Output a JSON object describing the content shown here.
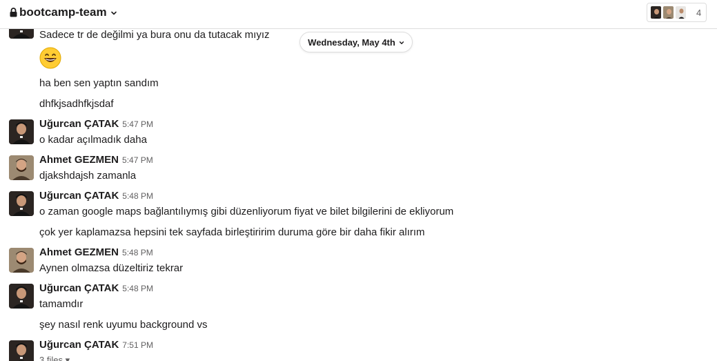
{
  "header": {
    "channel_name": "bootcamp-team",
    "member_count": "4",
    "lock_icon": "lock-icon",
    "chevron_icon": "chevron-down-icon"
  },
  "date_divider": {
    "label": "Wednesday, May 4th"
  },
  "messages": [
    {
      "lines": [
        "Sadece tr de değilmi ya bura onu da tutacak mıyız"
      ]
    },
    {
      "emoji": "grinning-face-emoji"
    },
    {
      "lines": [
        "ha ben sen yaptın sandım"
      ]
    },
    {
      "lines": [
        "dhfkjsadhfkjsdaf"
      ]
    },
    {
      "author": "Uğurcan ÇATAK",
      "time": "5:47 PM",
      "lines": [
        "o kadar açılmadık daha"
      ]
    },
    {
      "author": "Ahmet GEZMEN",
      "time": "5:47 PM",
      "lines": [
        "djakshdajsh zamanla"
      ]
    },
    {
      "author": "Uğurcan ÇATAK",
      "time": "5:48 PM",
      "lines": [
        "o zaman google maps bağlantılıymış gibi düzenliyorum fiyat ve bilet bilgilerini de ekliyorum",
        "çok yer kaplamazsa hepsini tek sayfada birleştiririm duruma göre bir daha fikir alırım"
      ]
    },
    {
      "author": "Ahmet GEZMEN",
      "time": "5:48 PM",
      "lines": [
        "Aynen olmazsa düzeltiriz tekrar"
      ]
    },
    {
      "author": "Uğurcan ÇATAK",
      "time": "5:48 PM",
      "lines": [
        "tamamdır",
        "şey nasıl renk uyumu background vs"
      ]
    },
    {
      "author": "Uğurcan ÇATAK",
      "time": "7:51 PM",
      "files_label": "3 files"
    }
  ]
}
